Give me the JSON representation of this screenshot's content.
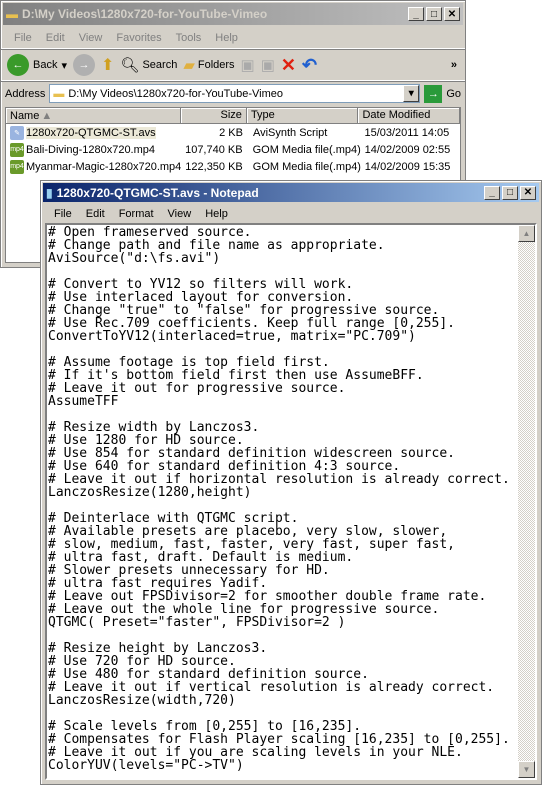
{
  "explorer": {
    "title": "D:\\My Videos\\1280x720-for-YouTube-Vimeo",
    "menu": [
      "File",
      "Edit",
      "View",
      "Favorites",
      "Tools",
      "Help"
    ],
    "toolbar": {
      "back": "Back",
      "search": "Search",
      "folders": "Folders",
      "more": "»"
    },
    "address": {
      "label": "Address",
      "value": "D:\\My Videos\\1280x720-for-YouTube-Vimeo",
      "go": "Go"
    },
    "columns": [
      "Name",
      "Size",
      "Type",
      "Date Modified"
    ],
    "files": [
      {
        "name": "1280x720-QTGMC-ST.avs",
        "size": "2 KB",
        "type": "AviSynth Script",
        "date": "15/03/2011 14:05",
        "icon": "script-icon"
      },
      {
        "name": "Bali-Diving-1280x720.mp4",
        "size": "107,740 KB",
        "type": "GOM Media file(.mp4)",
        "date": "14/02/2009 02:55",
        "icon": "mp4-icon"
      },
      {
        "name": "Myanmar-Magic-1280x720.mp4",
        "size": "122,350 KB",
        "type": "GOM Media file(.mp4)",
        "date": "14/02/2009 15:35",
        "icon": "mp4-icon"
      }
    ]
  },
  "notepad": {
    "title": "1280x720-QTGMC-ST.avs - Notepad",
    "menu": [
      "File",
      "Edit",
      "Format",
      "View",
      "Help"
    ],
    "content": "# Open frameserved source.\n# Change path and file name as appropriate.\nAviSource(\"d:\\fs.avi\")\n\n# Convert to YV12 so filters will work.\n# Use interlaced layout for conversion.\n# Change \"true\" to \"false\" for progressive source.\n# Use Rec.709 coefficients. Keep full range [0,255].\nConvertToYV12(interlaced=true, matrix=\"PC.709\")\n\n# Assume footage is top field first.\n# If it's bottom field first then use AssumeBFF.\n# Leave it out for progressive source.\nAssumeTFF\n\n# Resize width by Lanczos3.\n# Use 1280 for HD source.\n# Use 854 for standard definition widescreen source.\n# Use 640 for standard definition 4:3 source.\n# Leave it out if horizontal resolution is already correct.\nLanczosResize(1280,height)\n\n# Deinterlace with QTGMC script.\n# Available presets are placebo, very slow, slower,\n# slow, medium, fast, faster, very fast, super fast,\n# ultra fast, draft. Default is medium.\n# Slower presets unnecessary for HD.\n# ultra fast requires Yadif.\n# Leave out FPSDivisor=2 for smoother double frame rate.\n# Leave out the whole line for progressive source.\nQTGMC( Preset=\"faster\", FPSDivisor=2 )\n\n# Resize height by Lanczos3.\n# Use 720 for HD source.\n# Use 480 for standard definition source.\n# Leave it out if vertical resolution is already correct.\nLanczosResize(width,720)\n\n# Scale levels from [0,255] to [16,235].\n# Compensates for Flash Player scaling [16,235] to [0,255].\n# Leave it out if you are scaling levels in your NLE.\nColorYUV(levels=\"PC->TV\")"
  }
}
